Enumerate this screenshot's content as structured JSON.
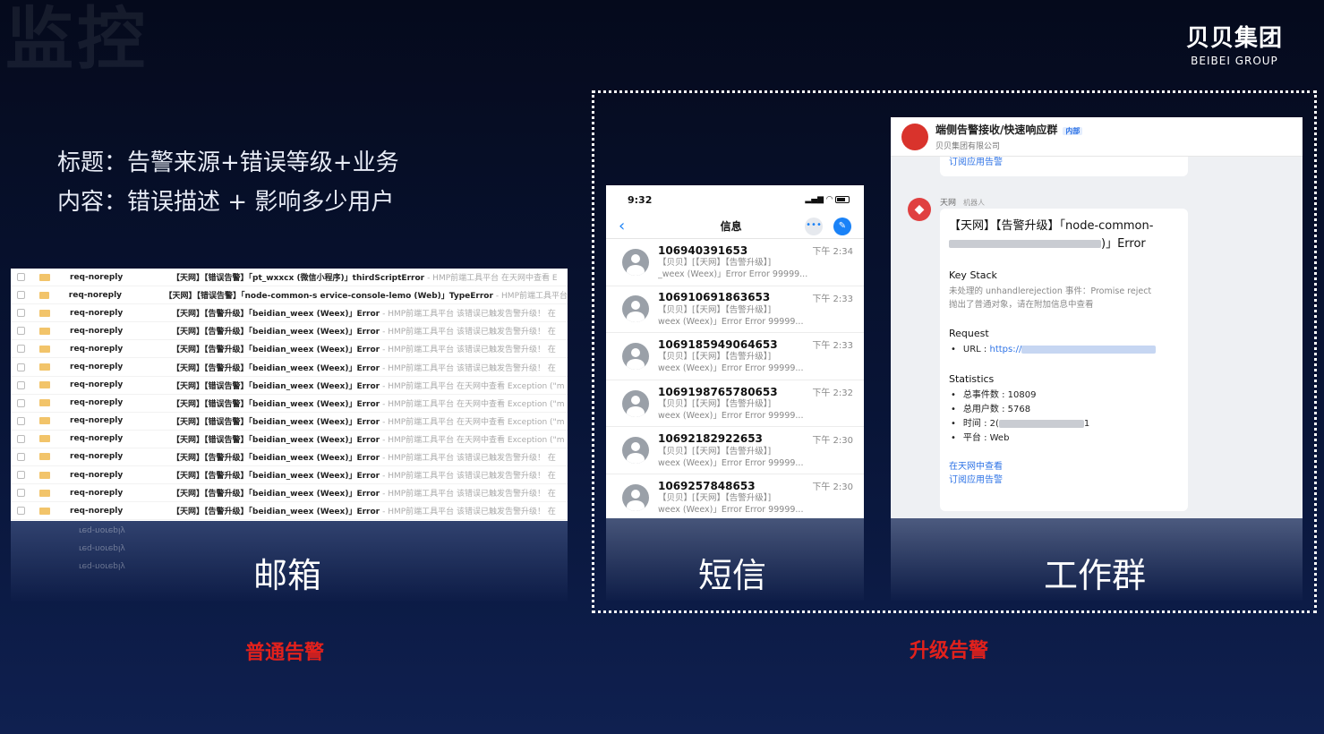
{
  "slide": {
    "title": "监控",
    "logo_cn": "贝贝集团",
    "logo_en": "BEIBEI GROUP",
    "desc_line1": "标题：告警来源+错误等级+业务",
    "desc_line2": "内容：错误描述 + 影响多少用户"
  },
  "captions": {
    "mail": "邮箱",
    "sms": "短信",
    "workgroup": "工作群"
  },
  "labels": {
    "normal": "普通告警",
    "upgrade": "升级告警"
  },
  "mail": {
    "rows": [
      {
        "sender": "req-noreply",
        "subject": "【天网】【错误告警】「pt_wxxcx (微信小程序)」thirdScriptError",
        "preview": "- HMP前端工具平台 在天网中查看 E"
      },
      {
        "sender": "req-noreply",
        "subject": "【天网】【错误告警】「node-common-s ervice-console-lemo (Web)」TypeError",
        "preview": "- HMP前端工具平台"
      },
      {
        "sender": "req-noreply",
        "subject": "【天网】【告警升级】「beidian_weex (Weex)」Error",
        "preview": "- HMP前端工具平台 该错误已触发告警升级！ 在"
      },
      {
        "sender": "req-noreply",
        "subject": "【天网】【告警升级】「beidian_weex (Weex)」Error",
        "preview": "- HMP前端工具平台 该错误已触发告警升级！ 在"
      },
      {
        "sender": "req-noreply",
        "subject": "【天网】【告警升级】「beidian_weex (Weex)」Error",
        "preview": "- HMP前端工具平台 该错误已触发告警升级！ 在"
      },
      {
        "sender": "req-noreply",
        "subject": "【天网】【告警升级】「beidian_weex (Weex)」Error",
        "preview": "- HMP前端工具平台 该错误已触发告警升级！ 在"
      },
      {
        "sender": "req-noreply",
        "subject": "【天网】【错误告警】「beidian_weex (Weex)」Error",
        "preview": "- HMP前端工具平台 在天网中查看 Exception (\"m"
      },
      {
        "sender": "req-noreply",
        "subject": "【天网】【错误告警】「beidian_weex (Weex)」Error",
        "preview": "- HMP前端工具平台 在天网中查看 Exception (\"m"
      },
      {
        "sender": "req-noreply",
        "subject": "【天网】【错误告警】「beidian_weex (Weex)」Error",
        "preview": "- HMP前端工具平台 在天网中查看 Exception (\"m"
      },
      {
        "sender": "req-noreply",
        "subject": "【天网】【错误告警】「beidian_weex (Weex)」Error",
        "preview": "- HMP前端工具平台 在天网中查看 Exception (\"m"
      },
      {
        "sender": "req-noreply",
        "subject": "【天网】【告警升级】「beidian_weex (Weex)」Error",
        "preview": "- HMP前端工具平台 该错误已触发告警升级！ 在"
      },
      {
        "sender": "req-noreply",
        "subject": "【天网】【告警升级】「beidian_weex (Weex)」Error",
        "preview": "- HMP前端工具平台 该错误已触发告警升级！ 在"
      },
      {
        "sender": "req-noreply",
        "subject": "【天网】【告警升级】「beidian_weex (Weex)」Error",
        "preview": "- HMP前端工具平台 该错误已触发告警升级！ 在"
      },
      {
        "sender": "req-noreply",
        "subject": "【天网】【告警升级】「beidian_weex (Weex)」Error",
        "preview": "- HMP前端工具平台 该错误已触发告警升级！ 在"
      }
    ]
  },
  "sms": {
    "time": "9:32",
    "nav_title": "信息",
    "messages": [
      {
        "number": "106940391653",
        "time": "下午 2:34",
        "line1": "【贝贝】[【天网】【告警升级】]",
        "line2": "_weex (Weex)」Error Error 99999..."
      },
      {
        "number": "106910691863653",
        "time": "下午 2:33",
        "line1": "【贝贝】[【天网】【告警升级】]",
        "line2": "weex (Weex)」Error Error 99999..."
      },
      {
        "number": "1069185949064653",
        "time": "下午 2:33",
        "line1": "【贝贝】[【天网】【告警升级】]",
        "line2": "weex (Weex)」Error Error 99999..."
      },
      {
        "number": "1069198765780653",
        "time": "下午 2:32",
        "line1": "【贝贝】[【天网】【告警升级】]",
        "line2": "weex (Weex)」Error Error 99999..."
      },
      {
        "number": "10692182922653",
        "time": "下午 2:30",
        "line1": "【贝贝】[【天网】【告警升级】]",
        "line2": "weex (Weex)」Error Error 99999..."
      },
      {
        "number": "1069257848653",
        "time": "下午 2:30",
        "line1": "【贝贝】[【天网】【告警升级】]",
        "line2": "weex (Weex)」Error Error 99999..."
      }
    ]
  },
  "workgroup": {
    "group_name": "端侧告警接收/快速响应群",
    "group_tag": "内部",
    "org": "贝贝集团有限公司",
    "prev_link": "订阅应用告警",
    "bot_name": "天网",
    "bot_tag": "机器人",
    "card_title_a": "【天网】【告警升级】「node-common-",
    "card_title_b": ")」Error",
    "key_stack_h": "Key Stack",
    "key_stack_1": "未处理的 unhandlerejection 事件：Promise reject",
    "key_stack_2": "抛出了普通对象，请在附加信息中查看",
    "request_h": "Request",
    "url_label": "URL : ",
    "url_value": "https://",
    "statistics_h": "Statistics",
    "stat_events": "总事件数 : 10809",
    "stat_users": "总用户数 : 5768",
    "stat_time_a": "时间 : 2(",
    "stat_time_b": "1",
    "stat_platform": "平台 : Web",
    "link_view": "在天网中查看",
    "link_subscribe": "订阅应用告警"
  }
}
